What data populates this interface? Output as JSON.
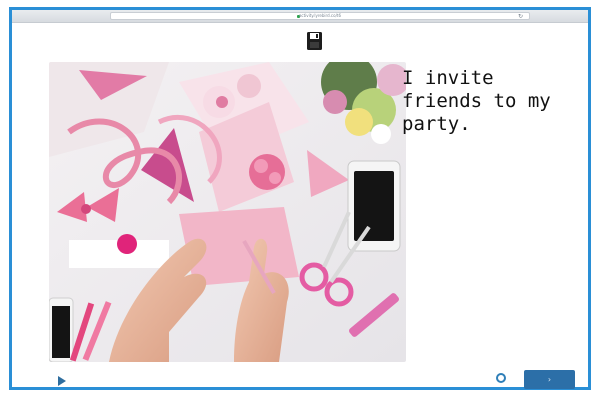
{
  "browser": {
    "url": "activity.lyrebird.co/t6"
  },
  "icons": {
    "save": "floppy-disk-icon",
    "lock": "lock-icon",
    "reload": "reload-icon",
    "play": "play-icon",
    "loading": "loading-circle-icon"
  },
  "slide": {
    "caption": "I invite friends to my party."
  },
  "controls": {
    "next_label": "›"
  },
  "colors": {
    "frame_border": "#2a8fd6",
    "next_button": "#2c6fa8",
    "play_icon": "#2f6e9f"
  }
}
